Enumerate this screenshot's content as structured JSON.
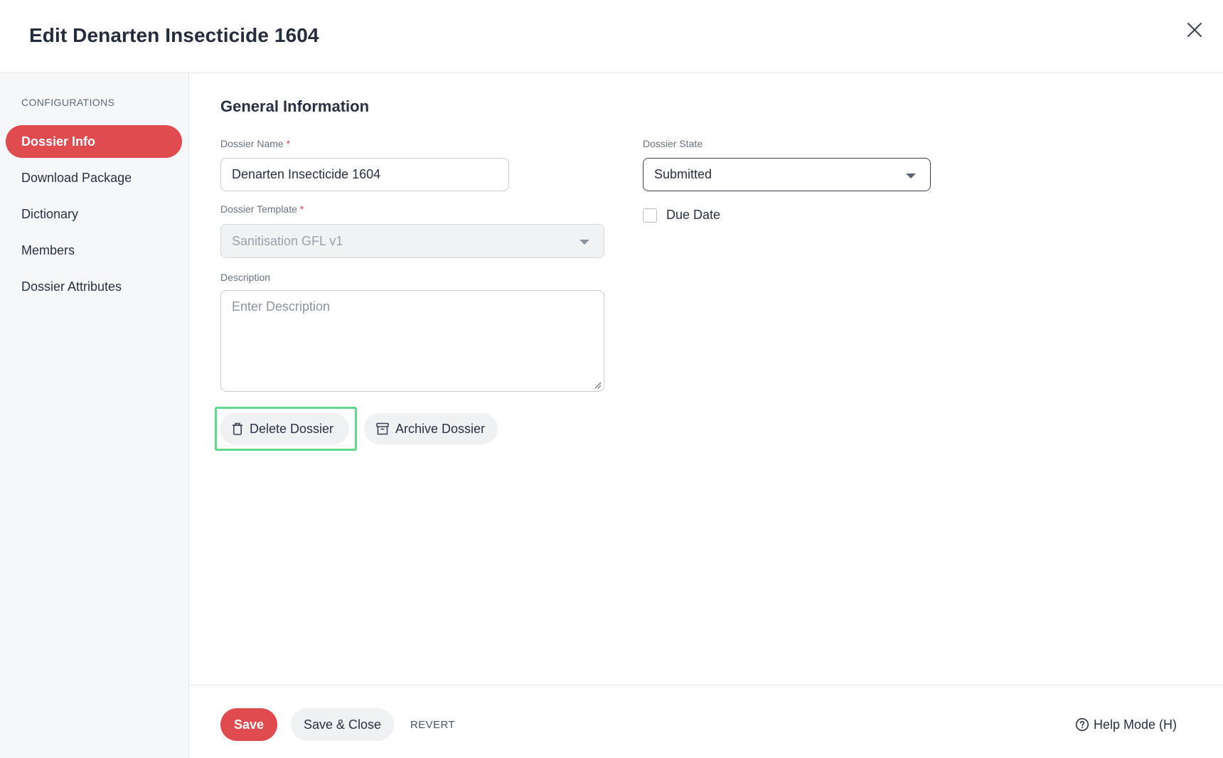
{
  "header": {
    "title": "Edit Denarten Insecticide 1604"
  },
  "sidebar": {
    "section_label": "CONFIGURATIONS",
    "items": [
      {
        "label": "Dossier Info",
        "active": true
      },
      {
        "label": "Download Package",
        "active": false
      },
      {
        "label": "Dictionary",
        "active": false
      },
      {
        "label": "Members",
        "active": false
      },
      {
        "label": "Dossier Attributes",
        "active": false
      }
    ]
  },
  "main": {
    "section_title": "General Information",
    "dossier_name": {
      "label": "Dossier Name",
      "required_mark": "*",
      "value": "Denarten Insecticide 1604"
    },
    "dossier_template": {
      "label": "Dossier Template",
      "required_mark": "*",
      "value": "Sanitisation GFL v1",
      "disabled": true
    },
    "description": {
      "label": "Description",
      "placeholder": "Enter Description",
      "value": ""
    },
    "dossier_state": {
      "label": "Dossier State",
      "value": "Submitted"
    },
    "due_date": {
      "label": "Due Date",
      "checked": false
    },
    "actions": {
      "delete_label": "Delete Dossier",
      "archive_label": "Archive Dossier"
    }
  },
  "footer": {
    "save_label": "Save",
    "save_close_label": "Save & Close",
    "revert_label": "REVERT",
    "help_mode_label": "Help Mode (H)"
  },
  "colors": {
    "accent": "#e04b50",
    "highlight": "#5fd88a",
    "text": "#283041"
  },
  "icons": [
    "close-icon",
    "trash-icon",
    "archive-icon",
    "chevron-down-icon",
    "help-circle-icon",
    "resize-grip-icon"
  ]
}
